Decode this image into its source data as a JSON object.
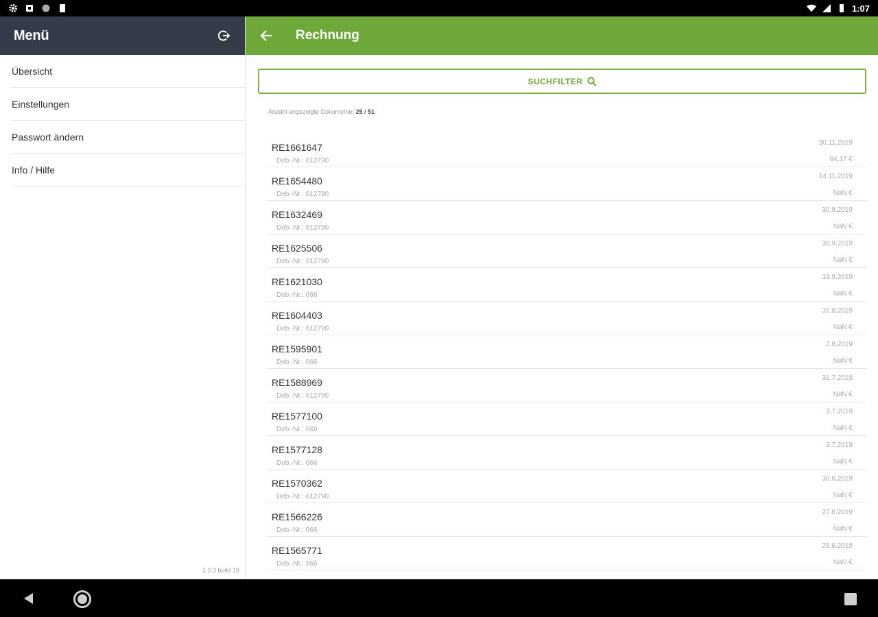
{
  "status_bar": {
    "time": "1:07",
    "left_icons": [
      "settings-icon",
      "notification-icon",
      "sync-icon",
      "sd-card-icon"
    ],
    "right_icons": [
      "wifi-icon",
      "signal-icon",
      "battery-icon"
    ]
  },
  "sidebar": {
    "title": "Menü",
    "items": [
      {
        "label": "Übersicht"
      },
      {
        "label": "Einstellungen"
      },
      {
        "label": "Passwort ändern"
      },
      {
        "label": "Info / Hilfe"
      }
    ],
    "version": "1.0.3 build 19"
  },
  "header": {
    "title": "Rechnung"
  },
  "filter": {
    "label": "SUCHFILTER"
  },
  "count": {
    "label": "Anzahl angezeigte Dokumente:",
    "value": "25 / 51"
  },
  "invoices": [
    {
      "id": "RE1661647",
      "deb": "Deb.-Nr.: 612790",
      "date": "30.11.2019",
      "amount": "84,17 €"
    },
    {
      "id": "RE1654480",
      "deb": "Deb.-Nr.: 612790",
      "date": "14.11.2019",
      "amount": "NaN €"
    },
    {
      "id": "RE1632469",
      "deb": "Deb.-Nr.: 612790",
      "date": "30.9.2019",
      "amount": "NaN €"
    },
    {
      "id": "RE1625506",
      "deb": "Deb.-Nr.: 612790",
      "date": "30.9.2019",
      "amount": "NaN €"
    },
    {
      "id": "RE1621030",
      "deb": "Deb.-Nr.: 666",
      "date": "19.9.2019",
      "amount": "NaN €"
    },
    {
      "id": "RE1604403",
      "deb": "Deb.-Nr.: 612790",
      "date": "31.8.2019",
      "amount": "NaN €"
    },
    {
      "id": "RE1595901",
      "deb": "Deb.-Nr.: 666",
      "date": "2.8.2019",
      "amount": "NaN €"
    },
    {
      "id": "RE1588969",
      "deb": "Deb.-Nr.: 612790",
      "date": "31.7.2019",
      "amount": "NaN €"
    },
    {
      "id": "RE1577100",
      "deb": "Deb.-Nr.: 666",
      "date": "3.7.2019",
      "amount": "NaN €"
    },
    {
      "id": "RE1577128",
      "deb": "Deb.-Nr.: 666",
      "date": "3.7.2019",
      "amount": "NaN €"
    },
    {
      "id": "RE1570362",
      "deb": "Deb.-Nr.: 612790",
      "date": "30.6.2019",
      "amount": "NaN €"
    },
    {
      "id": "RE1566226",
      "deb": "Deb.-Nr.: 666",
      "date": "27.6.2019",
      "amount": "NaN €"
    },
    {
      "id": "RE1565771",
      "deb": "Deb.-Nr.: 666",
      "date": "25.6.2019",
      "amount": "NaN €"
    }
  ],
  "colors": {
    "accent_green": "#6ea83b",
    "sidebar_header": "#353b48"
  }
}
